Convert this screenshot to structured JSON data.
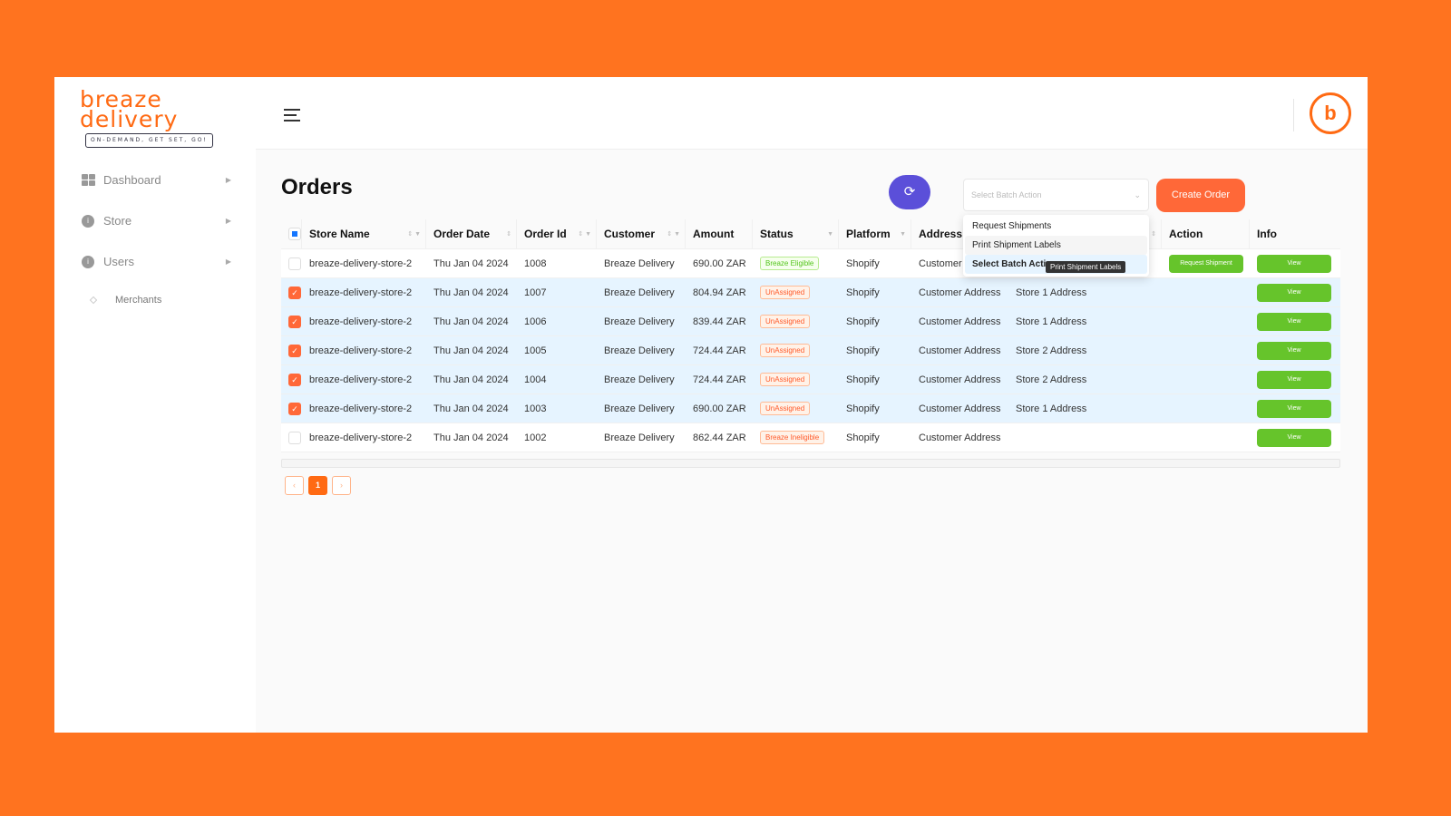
{
  "brand": {
    "name_line1": "breaze",
    "name_line2": "delivery",
    "tagline": "ON-DEMAND, GET SET, GO!",
    "accent": "#ff6a13"
  },
  "sidebar": {
    "items": [
      {
        "label": "Dashboard",
        "icon": "dashboard-icon"
      },
      {
        "label": "Store",
        "icon": "info-icon"
      },
      {
        "label": "Users",
        "icon": "info-icon"
      }
    ],
    "sub_items": [
      {
        "label": "Merchants"
      }
    ]
  },
  "header": {
    "avatar_letter": "b"
  },
  "page": {
    "title": "Orders",
    "create_label": "Create Order",
    "refresh_icon": "refresh-icon",
    "batch_placeholder": "Select Batch Action"
  },
  "batch_menu": {
    "options": [
      "Request Shipments",
      "Print Shipment Labels",
      "Select Batch Action"
    ],
    "tooltip": "Print Shipment Labels"
  },
  "table": {
    "columns": [
      "Store Name",
      "Order Date",
      "Order Id",
      "Customer",
      "Amount",
      "Status",
      "Platform",
      "Address",
      "",
      "Action",
      "Info"
    ],
    "rows": [
      {
        "checked": false,
        "store": "breaze-delivery-store-2",
        "date": "Thu Jan 04 2024",
        "id": "1008",
        "customer": "Breaze Delivery",
        "amount": "690.00 ZAR",
        "status": "Breaze Eligible",
        "platform": "Shopify",
        "address": "Customer Address",
        "store_address": "",
        "action": "Request Shipment",
        "info": "View"
      },
      {
        "checked": true,
        "store": "breaze-delivery-store-2",
        "date": "Thu Jan 04 2024",
        "id": "1007",
        "customer": "Breaze Delivery",
        "amount": "804.94 ZAR",
        "status": "UnAssigned",
        "platform": "Shopify",
        "address": "Customer Address",
        "store_address": "Store 1 Address",
        "action": "",
        "info": "View"
      },
      {
        "checked": true,
        "store": "breaze-delivery-store-2",
        "date": "Thu Jan 04 2024",
        "id": "1006",
        "customer": "Breaze Delivery",
        "amount": "839.44 ZAR",
        "status": "UnAssigned",
        "platform": "Shopify",
        "address": "Customer Address",
        "store_address": "Store 1 Address",
        "action": "",
        "info": "View"
      },
      {
        "checked": true,
        "store": "breaze-delivery-store-2",
        "date": "Thu Jan 04 2024",
        "id": "1005",
        "customer": "Breaze Delivery",
        "amount": "724.44 ZAR",
        "status": "UnAssigned",
        "platform": "Shopify",
        "address": "Customer Address",
        "store_address": "Store 2 Address",
        "action": "",
        "info": "View"
      },
      {
        "checked": true,
        "store": "breaze-delivery-store-2",
        "date": "Thu Jan 04 2024",
        "id": "1004",
        "customer": "Breaze Delivery",
        "amount": "724.44 ZAR",
        "status": "UnAssigned",
        "platform": "Shopify",
        "address": "Customer Address",
        "store_address": "Store 2 Address",
        "action": "",
        "info": "View"
      },
      {
        "checked": true,
        "store": "breaze-delivery-store-2",
        "date": "Thu Jan 04 2024",
        "id": "1003",
        "customer": "Breaze Delivery",
        "amount": "690.00 ZAR",
        "status": "UnAssigned",
        "platform": "Shopify",
        "address": "Customer Address",
        "store_address": "Store 1 Address",
        "action": "",
        "info": "View"
      },
      {
        "checked": false,
        "store": "breaze-delivery-store-2",
        "date": "Thu Jan 04 2024",
        "id": "1002",
        "customer": "Breaze Delivery",
        "amount": "862.44 ZAR",
        "status": "Breaze Ineligible",
        "platform": "Shopify",
        "address": "Customer Address",
        "store_address": "",
        "action": "",
        "info": "View"
      }
    ]
  },
  "pagination": {
    "prev": "‹",
    "current": "1",
    "next": "›"
  }
}
